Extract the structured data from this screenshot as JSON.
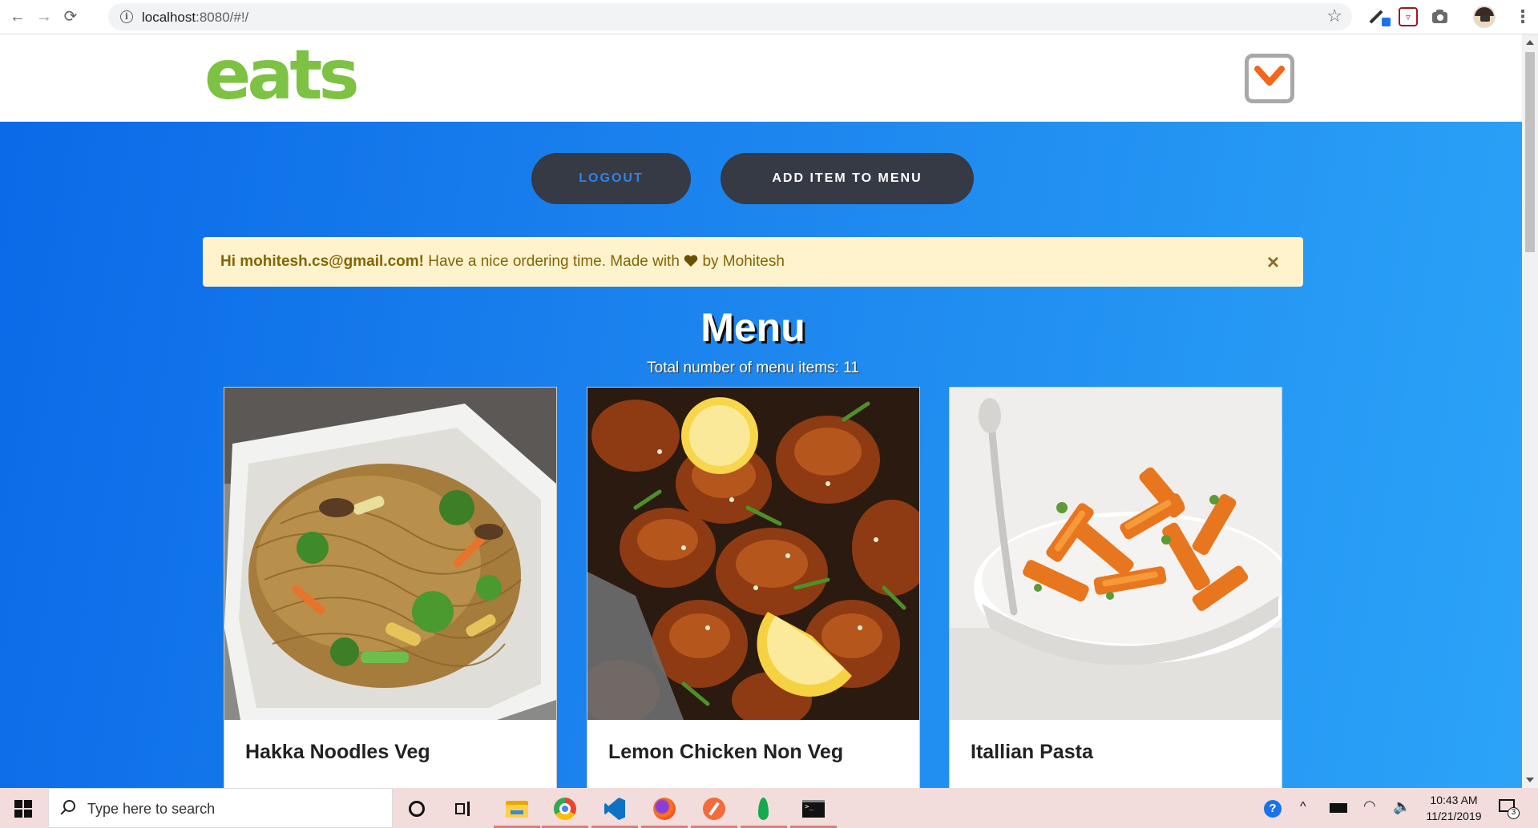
{
  "browser": {
    "url_host": "localhost",
    "url_rest": ":8080/#!/"
  },
  "site": {
    "logo_text": "eats",
    "logo_color": "#7dc242",
    "accent_color": "#f4661b"
  },
  "actions": {
    "logout_label": "LOGOUT",
    "add_item_label": "ADD ITEM TO MENU"
  },
  "alert": {
    "greeting": "Hi mohitesh.cs@gmail.com!",
    "message_before_heart": " Have a nice ordering time. Made with ",
    "message_after_heart": " by Mohitesh",
    "close_symbol": "×"
  },
  "menu": {
    "title": "Menu",
    "count_text": "Total number of menu items: 11",
    "items": [
      {
        "name": "Hakka Noodles Veg",
        "image": "noodles"
      },
      {
        "name": "Lemon Chicken Non Veg",
        "image": "chicken"
      },
      {
        "name": "Itallian Pasta",
        "image": "pasta"
      }
    ]
  },
  "taskbar": {
    "search_placeholder": "Type here to search",
    "time": "10:43 AM",
    "date": "11/21/2019",
    "notification_count": "3",
    "help_symbol": "?"
  }
}
